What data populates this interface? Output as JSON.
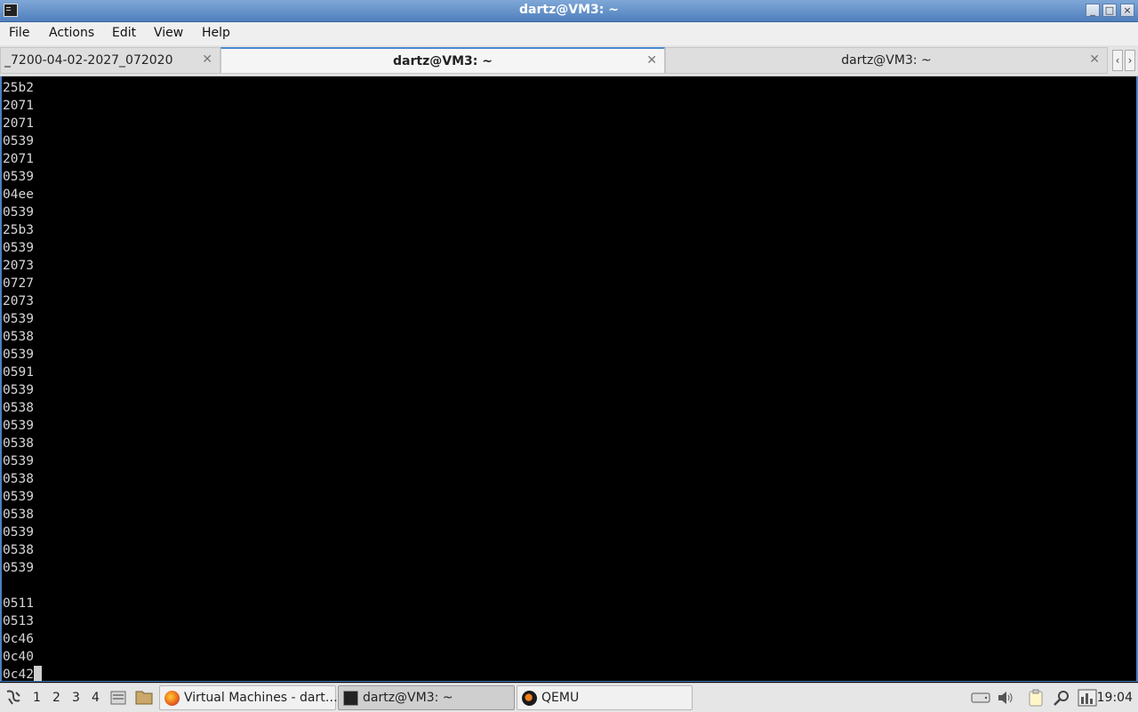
{
  "window": {
    "title": "dartz@VM3: ~",
    "icon": "terminal-icon",
    "controls": {
      "minimize": "_",
      "maximize": "□",
      "close": "×"
    }
  },
  "menu": [
    "File",
    "Actions",
    "Edit",
    "View",
    "Help"
  ],
  "tabs": [
    {
      "label": "_7200-04-02-2027_072020",
      "active": false
    },
    {
      "label": "dartz@VM3: ~",
      "active": true
    },
    {
      "label": "dartz@VM3: ~",
      "active": false
    }
  ],
  "tab_scroll": {
    "left": "‹",
    "right": "›"
  },
  "terminal": {
    "lines": [
      "25b2",
      "2071",
      "2071",
      "0539",
      "2071",
      "0539",
      "04ee",
      "0539",
      "25b3",
      "0539",
      "2073",
      "0727",
      "2073",
      "0539",
      "0538",
      "0539",
      "0591",
      "0539",
      "0538",
      "0539",
      "0538",
      "0539",
      "0538",
      "0539",
      "0538",
      "0539",
      "0538",
      "0539",
      "",
      "0511",
      "0513",
      "0c46",
      "0c40"
    ],
    "prompt_line": "0c42"
  },
  "taskbar": {
    "desktops": [
      "1",
      "2",
      "3",
      "4"
    ],
    "tasks": [
      {
        "label": "Virtual Machines - dart…",
        "icon": "firefox-icon",
        "active": false
      },
      {
        "label": "dartz@VM3: ~",
        "icon": "terminal-icon",
        "active": true
      },
      {
        "label": "QEMU",
        "icon": "qemu-icon",
        "active": false
      }
    ],
    "clock": "19:04"
  },
  "colors": {
    "accent": "#4a86d0",
    "terminal_bg": "#000000",
    "terminal_fg": "#d6d6d6"
  }
}
